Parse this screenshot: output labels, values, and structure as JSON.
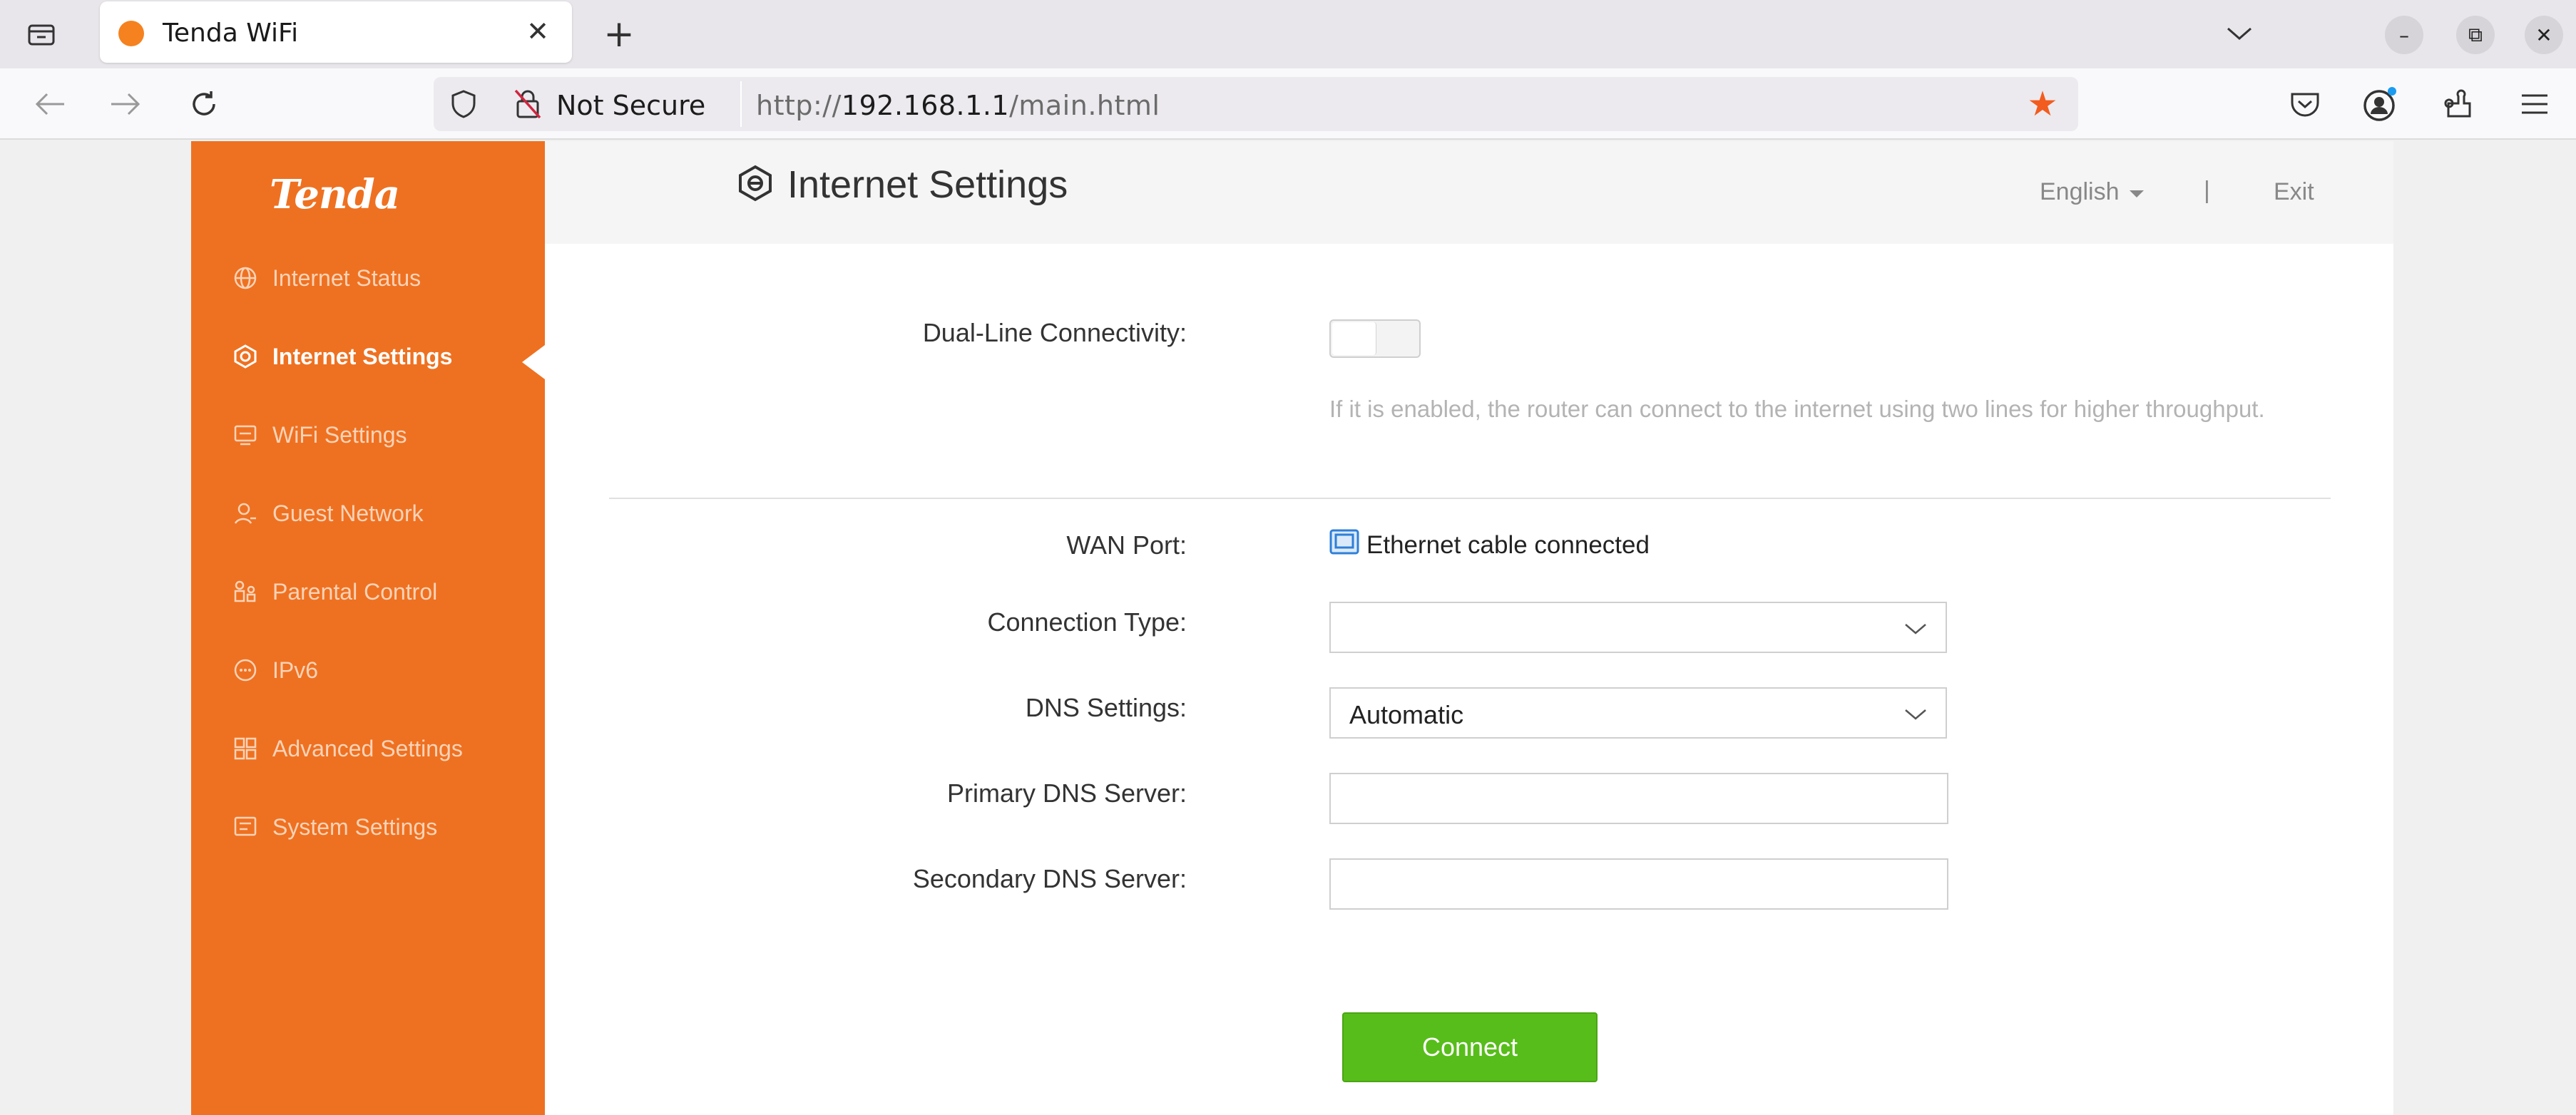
{
  "browser": {
    "tab_title": "Tenda WiFi",
    "tab_close": "✕",
    "new_tab": "+",
    "security_label": "Not Secure",
    "url_prefix": "http://",
    "url_host": "192.168.1.1",
    "url_path": "/main.html",
    "win_minimize": "–",
    "win_restore": "⧉",
    "win_close": "✕"
  },
  "sidebar": {
    "logo": "Tenda",
    "items": [
      {
        "label": "Internet Status",
        "icon": "globe-icon"
      },
      {
        "label": "Internet Settings",
        "icon": "internet-settings-icon",
        "active": true
      },
      {
        "label": "WiFi Settings",
        "icon": "wifi-settings-icon"
      },
      {
        "label": "Guest Network",
        "icon": "guest-icon"
      },
      {
        "label": "Parental Control",
        "icon": "parental-icon"
      },
      {
        "label": "IPv6",
        "icon": "ipv6-icon"
      },
      {
        "label": "Advanced Settings",
        "icon": "grid-icon"
      },
      {
        "label": "System Settings",
        "icon": "system-icon"
      }
    ]
  },
  "header": {
    "title": "Internet Settings",
    "language": "English",
    "separator": "|",
    "exit": "Exit"
  },
  "form": {
    "dual_line_label": "Dual-Line Connectivity:",
    "dual_line_enabled": false,
    "dual_line_hint": "If it is enabled, the router can connect to the internet using two lines for higher throughput.",
    "wan_port_label": "WAN Port:",
    "wan_port_status": "Ethernet cable connected",
    "connection_type_label": "Connection Type:",
    "connection_type_value": "",
    "dns_settings_label": "DNS Settings:",
    "dns_settings_value": "Automatic",
    "primary_dns_label": "Primary DNS Server:",
    "primary_dns_value": "",
    "secondary_dns_label": "Secondary DNS Server:",
    "secondary_dns_value": "",
    "connect_button": "Connect"
  },
  "colors": {
    "brand_orange": "#ee7121",
    "connect_green": "#57bd1a",
    "star_orange": "#f25c1f"
  }
}
